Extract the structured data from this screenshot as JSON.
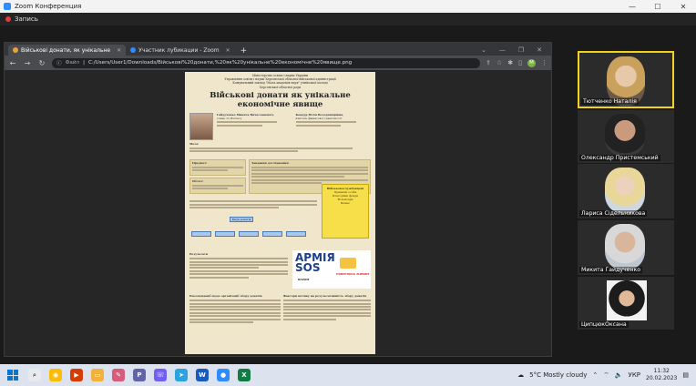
{
  "zoom": {
    "title": "Zoom Конференция",
    "recording_label": "Запись"
  },
  "browser": {
    "tabs": [
      {
        "label": "Військові донати, як унікальне"
      },
      {
        "label": "Участник лубикации - Zoom"
      }
    ],
    "address": {
      "scheme": "Файл",
      "url": "C:/Users/User1/Downloads/Військові%20донати,%20як%20унікальне%20економічне%20явище.png"
    },
    "profile_initial": "M"
  },
  "poster": {
    "header_lines": [
      "Міністерство освіти і науки України",
      "Управління освіти і науки Херсонської обласної військової адміністрації",
      "Комунальний заклад \"Мала академія наук\" учнівської молоді",
      "Херсонської обласної ради"
    ],
    "title": "Військові донати як унікальне економічне явище",
    "author_name": "Гайдученко Микита Вячеславович,",
    "author_detail": "учень 11-Ф класу",
    "supervisor_name": "Кондур Юлія Володимирівна,",
    "supervisor_role": "вчитель фінансової грамотності",
    "section_goal": "Мета:",
    "section_tasks": "Завдання дослідження:",
    "section_subject": "Предмет:",
    "section_object": "Об'єкт:",
    "section_results": "Результати",
    "section_factors": "Фактори впливу на результативність збору донатів",
    "section_recommend": "Рекомендації щодо організації збору донатів",
    "diagram_root": "Види донатів",
    "yellow_title": "Військовослужбовцеві",
    "yellow_items": [
      "Приватні особи",
      "Благодійні фонди",
      "Волонтери",
      "Бізнес"
    ],
    "logo_army_line1": "АРМІЯ",
    "logo_army_line2": "SOS",
    "logo_razom": "RAZOM",
    "logo_povernis": "ПОВЕРНИСЬ ЖИВИМ"
  },
  "participants": [
    {
      "name": "Тютченко Наталія",
      "active": true
    },
    {
      "name": "Олександр Пристемський",
      "active": false
    },
    {
      "name": "Лариса Сідельникова",
      "active": false
    },
    {
      "name": "Микита Гайдученко",
      "active": false
    },
    {
      "name": "ЦипцюкОксана",
      "active": false
    }
  ],
  "taskbar": {
    "weather": "5°C  Mostly cloudy",
    "language": "УКР",
    "time": "11:32",
    "date": "20.02.2023"
  }
}
